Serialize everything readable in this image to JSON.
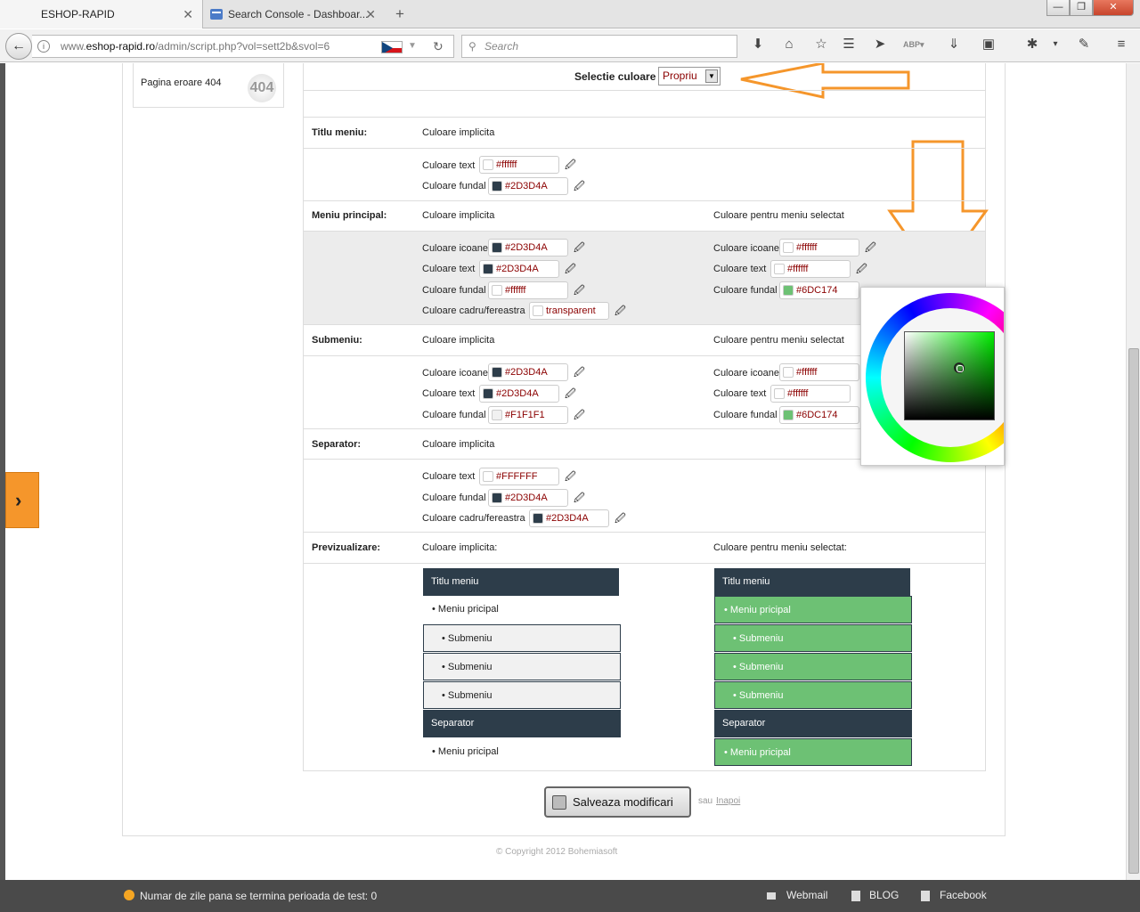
{
  "browser": {
    "tabs": [
      {
        "label": "ESHOP-RAPID"
      },
      {
        "label": "Search Console - Dashboar..."
      }
    ],
    "new_tab": "+",
    "url_prefix": "www.",
    "url_domain": "eshop-rapid.ro",
    "url_path": "/admin/script.php?vol=sett2b&svol=6",
    "search_placeholder": "Search"
  },
  "sidebar": {
    "item_label": "Pagina eroare 404",
    "item_icon_text": "404"
  },
  "selection": {
    "label": "Selectie culoare",
    "value": "Propriu"
  },
  "sections": {
    "titlu": {
      "label": "Titlu meniu:",
      "default": "Culoare implicita"
    },
    "meniu": {
      "label": "Meniu principal:",
      "default": "Culoare implicita",
      "selected": "Culoare pentru meniu selectat"
    },
    "submeniu": {
      "label": "Submeniu:",
      "default": "Culoare implicita",
      "selected": "Culoare pentru meniu selectat"
    },
    "separator": {
      "label": "Separator:",
      "default": "Culoare implicita"
    },
    "preview": {
      "label": "Previzualizare:",
      "default": "Culoare implicita:",
      "selected": "Culoare pentru meniu selectat:"
    }
  },
  "fields": {
    "titlu_text": {
      "label": "Culoare text",
      "value": "#ffffff",
      "swatch": "#ffffff"
    },
    "titlu_fundal": {
      "label": "Culoare fundal",
      "value": "#2D3D4A",
      "swatch": "#2D3D4A"
    },
    "mp_icoane": {
      "label": "Culoare icoane",
      "value": "#2D3D4A",
      "swatch": "#2D3D4A"
    },
    "mp_text": {
      "label": "Culoare text",
      "value": "#2D3D4A",
      "swatch": "#2D3D4A"
    },
    "mp_fundal": {
      "label": "Culoare fundal",
      "value": "#ffffff",
      "swatch": "#ffffff"
    },
    "mp_cadru": {
      "label": "Culoare cadru/fereastra",
      "value": "transparent",
      "swatch": "#ffffff"
    },
    "mps_icoane": {
      "label": "Culoare icoane",
      "value": "#ffffff",
      "swatch": "#ffffff"
    },
    "mps_text": {
      "label": "Culoare text",
      "value": "#ffffff",
      "swatch": "#ffffff"
    },
    "mps_fundal": {
      "label": "Culoare fundal",
      "value": "#6DC174",
      "swatch": "#6DC174"
    },
    "sm_icoane": {
      "label": "Culoare icoane",
      "value": "#2D3D4A",
      "swatch": "#2D3D4A"
    },
    "sm_text": {
      "label": "Culoare text",
      "value": "#2D3D4A",
      "swatch": "#2D3D4A"
    },
    "sm_fundal": {
      "label": "Culoare fundal",
      "value": "#F1F1F1",
      "swatch": "#F1F1F1"
    },
    "sms_icoane": {
      "label": "Culoare icoane",
      "value": "#ffffff",
      "swatch": "#ffffff"
    },
    "sms_text": {
      "label": "Culoare text",
      "value": "#ffffff",
      "swatch": "#ffffff"
    },
    "sms_fundal": {
      "label": "Culoare fundal",
      "value": "#6DC174",
      "swatch": "#6DC174"
    },
    "sep_text": {
      "label": "Culoare text",
      "value": "#FFFFFF",
      "swatch": "#FFFFFF"
    },
    "sep_fundal": {
      "label": "Culoare fundal",
      "value": "#2D3D4A",
      "swatch": "#2D3D4A"
    },
    "sep_cadru": {
      "label": "Culoare cadru/fereastra",
      "value": "#2D3D4A",
      "swatch": "#2D3D4A"
    }
  },
  "preview": {
    "title": "Titlu meniu",
    "main_item": "• Meniu pricipal",
    "main_item_2": "• Meniu pricipal",
    "sub_item": "• Submeniu",
    "separator": "Separator"
  },
  "actions": {
    "save_label": "Salveaza modificari",
    "or_label": "sau",
    "back_label": "Inapoi"
  },
  "copyright": "© Copyright 2012 Bohemiasoft",
  "footer": {
    "test_notice": "Numar de zile pana se termina perioada de test: 0",
    "links": [
      "Webmail",
      "BLOG",
      "Facebook"
    ]
  },
  "colors": {
    "accent_orange": "#F5962B",
    "menu_dark": "#2D3D4A",
    "menu_selected": "#6DC174",
    "value_text": "#8B0000"
  }
}
